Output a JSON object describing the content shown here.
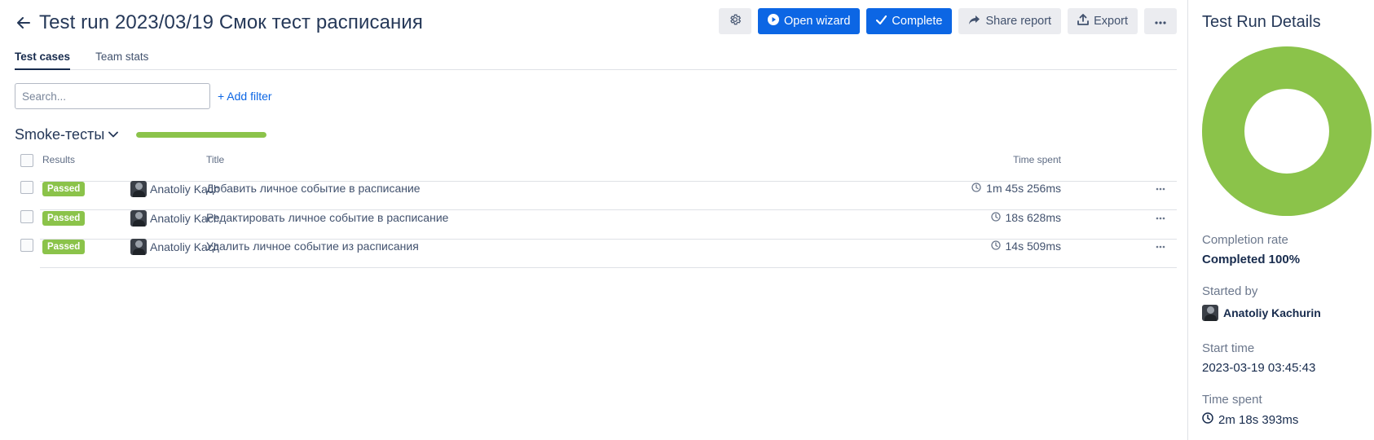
{
  "header": {
    "title": "Test run 2023/03/19 Смок тест расписания",
    "buttons": {
      "open_wizard": "Open wizard",
      "complete": "Complete",
      "share_report": "Share report",
      "export": "Export"
    }
  },
  "tabs": [
    {
      "label": "Test cases",
      "active": true
    },
    {
      "label": "Team stats",
      "active": false
    }
  ],
  "search": {
    "placeholder": "Search...",
    "value": ""
  },
  "add_filter": "+ Add filter",
  "suite": {
    "name": "Smoke-тесты",
    "progress_percent": 100
  },
  "table": {
    "headers": {
      "results": "Results",
      "title": "Title",
      "time_spent": "Time spent"
    },
    "rows": [
      {
        "status": "Passed",
        "assignee": "Anatoliy Kachurin",
        "title": "Добавить личное событие в расписание",
        "time": "1m 45s 256ms"
      },
      {
        "status": "Passed",
        "assignee": "Anatoliy Kachurin",
        "title": "Редактировать личное событие в расписание",
        "time": "18s 628ms"
      },
      {
        "status": "Passed",
        "assignee": "Anatoliy Kachurin",
        "title": "Удалить личное событие из расписания",
        "time": "14s 509ms"
      }
    ]
  },
  "details": {
    "title": "Test Run Details",
    "completion_rate_label": "Completion rate",
    "completion_rate_value": "Completed 100%",
    "completion_fraction": 1.0,
    "started_by_label": "Started by",
    "started_by_value": "Anatoliy Kachurin",
    "start_time_label": "Start time",
    "start_time_value": "2023-03-19 03:45:43",
    "time_spent_label": "Time spent",
    "time_spent_value": "2m 18s 393ms"
  },
  "colors": {
    "primary": "#0c66e4",
    "passed": "#8bc34a",
    "text_dark": "#172b4d",
    "button_grey": "#ebecf0"
  },
  "icons": [
    "back-arrow-icon",
    "gear-icon",
    "play-circle-icon",
    "check-icon",
    "share-icon",
    "export-icon",
    "more-icon",
    "chevron-down-icon",
    "clock-icon"
  ]
}
